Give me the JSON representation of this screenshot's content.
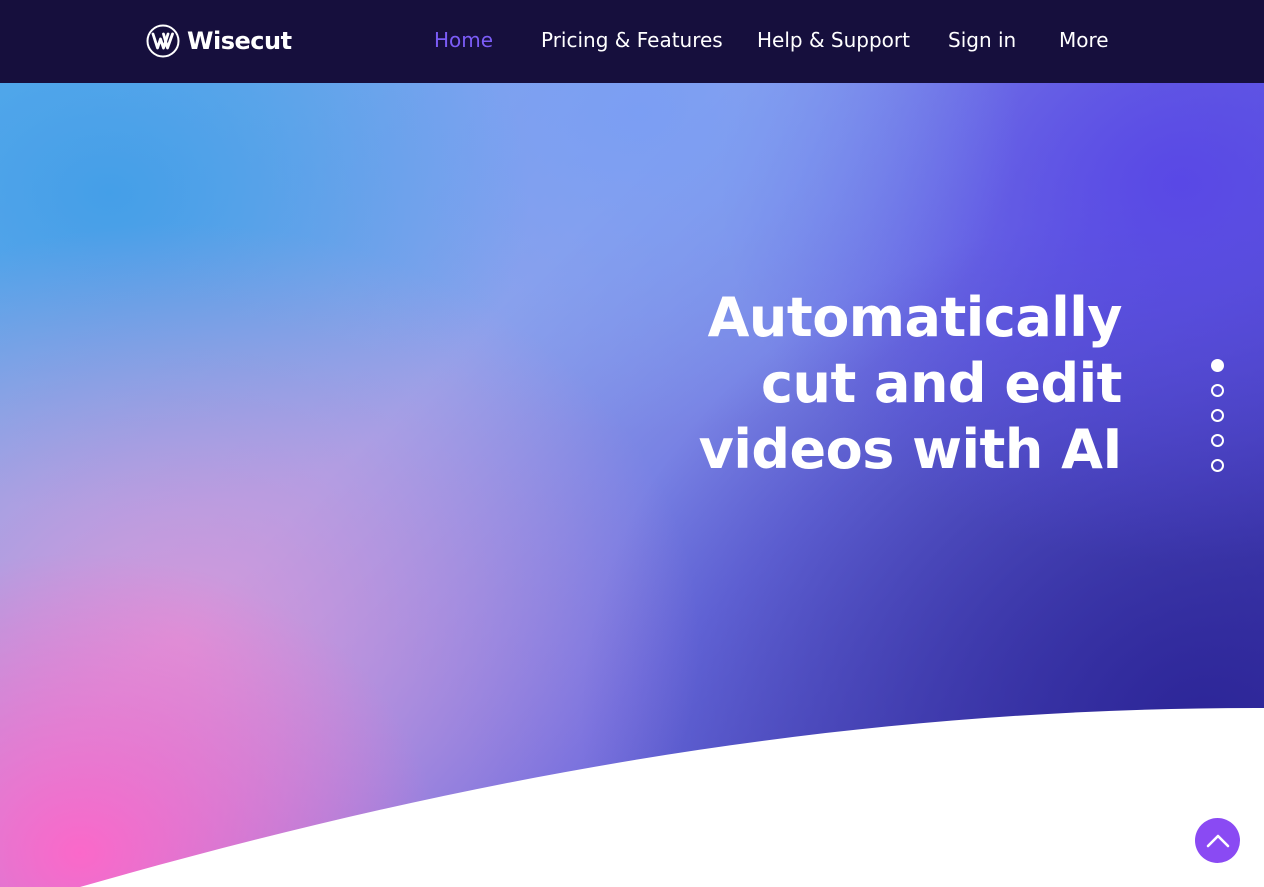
{
  "brand": {
    "name": "Wisecut",
    "logo_icon": "wisecut-w-logo-icon"
  },
  "nav": {
    "items": [
      {
        "label": "Home",
        "active": true
      },
      {
        "label": "Pricing & Features",
        "active": false
      },
      {
        "label": "Help & Support",
        "active": false
      },
      {
        "label": "Sign in",
        "active": false
      },
      {
        "label": "More",
        "active": false
      }
    ]
  },
  "hero": {
    "headline_lines": [
      "Automatically",
      "cut and edit",
      "videos with AI"
    ]
  },
  "slider": {
    "dot_count": 5,
    "active_index": 0
  },
  "scroll_top": {
    "icon": "chevron-up-icon"
  },
  "colors": {
    "header_bg": "#160f3d",
    "nav_active": "#7b5cf7",
    "nav_text": "#ffffff",
    "scroll_top_bg": "#8a4af3",
    "gradient_blue": "#429ee8",
    "gradient_pink": "#ff66c8",
    "gradient_indigo": "#2b2496"
  }
}
